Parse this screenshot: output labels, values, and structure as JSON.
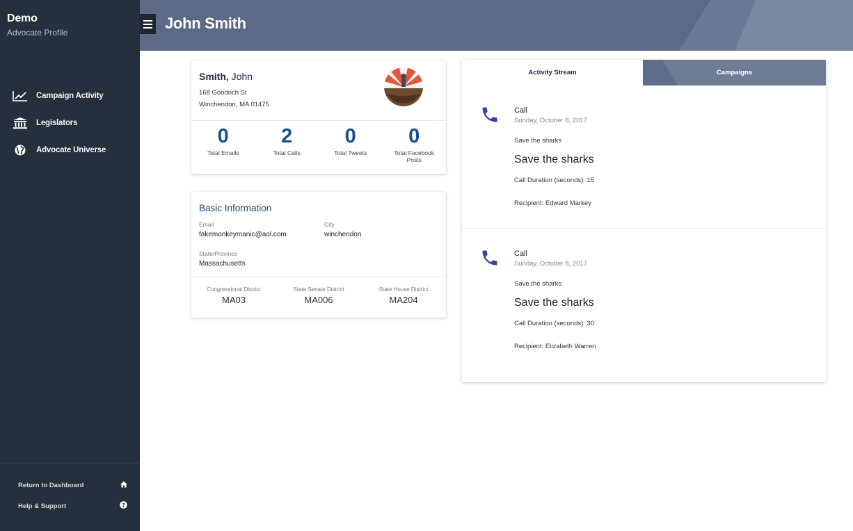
{
  "brand": {
    "title": "Demo",
    "subtitle": "Advocate Profile"
  },
  "nav": [
    {
      "label": "Campaign Activity",
      "icon": "line-chart-icon"
    },
    {
      "label": "Legislators",
      "icon": "capitol-building-icon"
    },
    {
      "label": "Advocate Universe",
      "icon": "globe-icon"
    }
  ],
  "footer": [
    {
      "label": "Return to Dashboard",
      "icon": "home-icon"
    },
    {
      "label": "Help & Support",
      "icon": "help-circle-icon"
    }
  ],
  "header": {
    "title": "John Smith",
    "menu_icon": "hamburger-icon"
  },
  "profile": {
    "last_name": "Smith,",
    "first_name": "John",
    "address_line1": "168 Goodrich St",
    "address_line2": "Winchendon, MA 01475",
    "stats": [
      {
        "value": "0",
        "label": "Total Emails"
      },
      {
        "value": "2",
        "label": "Total Calls"
      },
      {
        "value": "0",
        "label": "Total Tweets"
      },
      {
        "value": "0",
        "label": "Total Facebook Posts"
      }
    ]
  },
  "basic_info": {
    "title": "Basic Information",
    "email_label": "Email",
    "email": "fakemonkeymanic@aol.com",
    "city_label": "City",
    "city": "winchendon",
    "state_label": "State/Province",
    "state": "Massachusetts",
    "districts": [
      {
        "label": "Congressional District",
        "value": "MA03"
      },
      {
        "label": "State Senate District",
        "value": "MA006"
      },
      {
        "label": "State House District",
        "value": "MA204"
      }
    ]
  },
  "activity": {
    "tabs": [
      "Activity Stream",
      "Campaigns"
    ],
    "active_tab": 0,
    "entries": [
      {
        "type": "Call",
        "date": "Sunday, October 8, 2017",
        "campaign": "Save the sharks",
        "heading": "Save the sharks",
        "duration": "Call Duration (seconds): 15",
        "recipient": "Recipient: Edward Markey"
      },
      {
        "type": "Call",
        "date": "Sunday, October 8, 2017",
        "campaign": "Save the sharks",
        "heading": "Save the sharks",
        "duration": "Call Duration (seconds): 30",
        "recipient": "Recipient: Elizabeth Warren"
      }
    ]
  },
  "colors": {
    "sidebar": "#262f3d",
    "header": "#5c6a87",
    "stat_number": "#1c4d8c",
    "phone_icon": "#3346a3"
  }
}
